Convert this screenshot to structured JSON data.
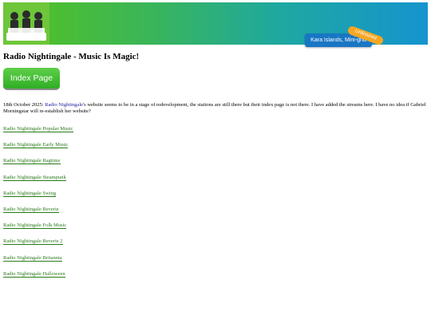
{
  "header": {
    "tag_label": "Kara Islands, Mini-grid",
    "ribbon_label": "Unfinished",
    "brand_color": "#55c21e",
    "tag_color": "#1876c4",
    "ribbon_color": "#f5a623"
  },
  "page": {
    "title": "Radio Nightingale - Music Is Magic!",
    "index_button_label": "Index Page"
  },
  "note": {
    "prefix": "18th October 2025: ",
    "link": "Radio Nightingale",
    "suffix": "'s website seems to be in a stage of redevelopment, the stations are still there but their index page is not there. I have added the streams here. I have no idea if Gabriel Morningstar will re-establish her website?"
  },
  "stations": [
    "Radio Nightingale Popular Music",
    "Radio Nightingale Early Music",
    "Radio Nightingale Ragtime",
    "Radio Nightingale Steampunk",
    "Radio Nightingale Swing",
    "Radio Nightingale Reverie",
    "Radio Nightingale Folk Music",
    "Radio Nightingale Reverie 2",
    "Radio Nightingale Britannia",
    "Radio Nightingale Halloween"
  ]
}
